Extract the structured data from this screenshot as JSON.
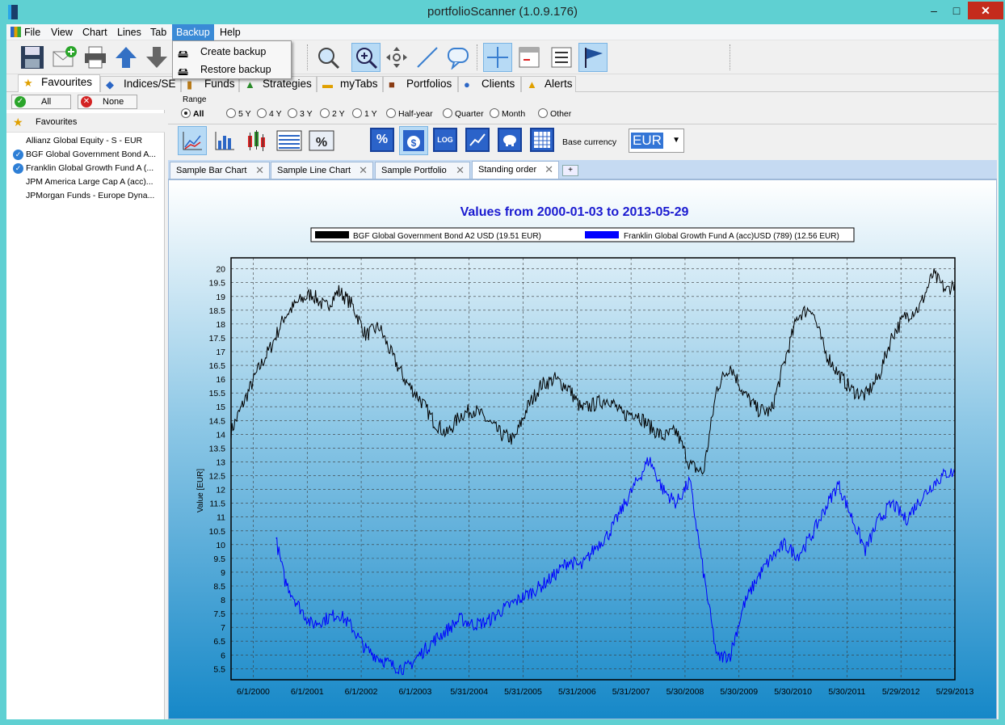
{
  "window": {
    "title": "portfolioScanner (1.0.9.176)",
    "min_glyph": "–",
    "max_glyph": "□",
    "close_glyph": "✕"
  },
  "menu": [
    "File",
    "View",
    "Chart",
    "Lines",
    "Tab",
    "Backup",
    "Help"
  ],
  "backup_menu": {
    "items": [
      "Create backup",
      "Restore backup"
    ]
  },
  "toolbar": {
    "icons": [
      "save-icon",
      "email-add-icon",
      "print-icon",
      "arrow-up-icon",
      "arrow-down-icon",
      "zoom-icon",
      "zoom-in-icon",
      "pan-icon",
      "line-draw-icon",
      "comment-icon",
      "crosshair-icon",
      "calendar-icon",
      "list-icon",
      "flag-icon"
    ]
  },
  "main_tabs": [
    "Favourites",
    "Indices/SE",
    "Funds",
    "Strategies",
    "myTabs",
    "Portfolios",
    "Clients",
    "Alerts"
  ],
  "left": {
    "all_label": "All",
    "none_label": "None",
    "header": "Favourites",
    "items": [
      {
        "label": "Allianz Global Equity - S - EUR",
        "checked": false
      },
      {
        "label": "BGF Global Government Bond A...",
        "checked": true
      },
      {
        "label": "Franklin Global Growth Fund A (...",
        "checked": true
      },
      {
        "label": "JPM America Large Cap A (acc)...",
        "checked": false
      },
      {
        "label": "JPMorgan Funds - Europe Dyna...",
        "checked": false
      }
    ]
  },
  "range": {
    "title": "Range",
    "options": [
      "All",
      "5 Y",
      "4 Y",
      "3 Y",
      "2 Y",
      "1 Y",
      "Half-year",
      "Quarter",
      "Month",
      "Other"
    ],
    "selected": "All"
  },
  "chart_tools": {
    "base_currency_label": "Base currency",
    "base_currency": "EUR",
    "percent_label": "%",
    "log_label": "LOG"
  },
  "chart_tabs": [
    "Sample Bar Chart",
    "Sample Line Chart",
    "Sample Portfolio",
    "Standing order"
  ],
  "chart_tabs_selected": "Standing order",
  "chart_data": {
    "type": "line",
    "title": "Values from 2000-01-03 to 2013-05-29",
    "ylabel": "Value [EUR]",
    "xlabel": "",
    "ylim": [
      5.1,
      20.4
    ],
    "yticks": [
      5.5,
      6,
      6.5,
      7,
      7.5,
      8,
      8.5,
      9,
      9.5,
      10,
      10.5,
      11,
      11.5,
      12,
      12.5,
      13,
      13.5,
      14,
      14.5,
      15,
      15.5,
      16,
      16.5,
      17,
      17.5,
      18,
      18.5,
      19,
      19.5,
      20
    ],
    "xlim": [
      "2000-01-03",
      "2013-05-29"
    ],
    "xticks": [
      "6/1/2000",
      "6/1/2001",
      "6/1/2002",
      "6/1/2003",
      "5/31/2004",
      "5/31/2005",
      "5/31/2006",
      "5/31/2007",
      "5/30/2008",
      "5/30/2009",
      "5/30/2010",
      "5/30/2011",
      "5/29/2012",
      "5/29/2013"
    ],
    "xtick_dates": [
      "2000-06-01",
      "2001-06-01",
      "2002-06-01",
      "2003-06-01",
      "2004-05-31",
      "2005-05-31",
      "2006-05-31",
      "2007-05-31",
      "2008-05-30",
      "2009-05-30",
      "2010-05-30",
      "2011-05-30",
      "2012-05-29",
      "2013-05-29"
    ],
    "grid": true,
    "legend_position": "top-center",
    "series": [
      {
        "name": "BGF Global Government Bond A2 USD (19.51 EUR)",
        "color": "#000000",
        "x": [
          "2000-01-03",
          "2000-04-01",
          "2000-07-01",
          "2000-10-01",
          "2001-01-01",
          "2001-04-01",
          "2001-07-01",
          "2001-10-01",
          "2002-01-01",
          "2002-04-01",
          "2002-07-01",
          "2002-10-01",
          "2003-01-01",
          "2003-04-01",
          "2003-07-01",
          "2003-10-01",
          "2004-01-01",
          "2004-04-01",
          "2004-07-01",
          "2004-10-01",
          "2005-01-01",
          "2005-04-01",
          "2005-07-01",
          "2005-10-01",
          "2006-01-01",
          "2006-04-01",
          "2006-07-01",
          "2006-10-01",
          "2007-01-01",
          "2007-04-01",
          "2007-07-01",
          "2007-10-01",
          "2008-01-01",
          "2008-04-01",
          "2008-07-01",
          "2008-10-01",
          "2009-01-01",
          "2009-04-01",
          "2009-07-01",
          "2009-10-01",
          "2010-01-01",
          "2010-04-01",
          "2010-07-01",
          "2010-10-01",
          "2011-01-01",
          "2011-04-01",
          "2011-07-01",
          "2011-10-01",
          "2012-01-01",
          "2012-04-01",
          "2012-07-01",
          "2012-10-01",
          "2013-01-01",
          "2013-04-01",
          "2013-05-29"
        ],
        "values": [
          14.1,
          15.2,
          16.3,
          17.2,
          18.3,
          18.8,
          19.1,
          18.6,
          19.2,
          18.7,
          17.6,
          17.9,
          16.8,
          15.9,
          15.3,
          14.5,
          14.0,
          14.7,
          14.9,
          14.5,
          14.0,
          13.8,
          15.0,
          15.8,
          16.0,
          15.7,
          14.9,
          15.1,
          15.3,
          14.7,
          14.8,
          14.3,
          13.9,
          14.1,
          12.9,
          12.6,
          15.7,
          16.5,
          15.5,
          14.9,
          14.8,
          16.6,
          18.3,
          18.6,
          17.0,
          16.2,
          15.6,
          15.4,
          16.1,
          17.6,
          18.3,
          18.6,
          19.8,
          19.2,
          19.5
        ]
      },
      {
        "name": "Franklin Global Growth Fund A (acc)USD (789) (12.56 EUR)",
        "color": "#0000ff",
        "x": [
          "2000-11-01",
          "2001-01-01",
          "2001-04-01",
          "2001-07-01",
          "2001-10-01",
          "2002-01-01",
          "2002-04-01",
          "2002-07-01",
          "2002-10-01",
          "2003-01-01",
          "2003-04-01",
          "2003-07-01",
          "2003-10-01",
          "2004-01-01",
          "2004-04-01",
          "2004-07-01",
          "2004-10-01",
          "2005-01-01",
          "2005-04-01",
          "2005-07-01",
          "2005-10-01",
          "2006-01-01",
          "2006-04-01",
          "2006-07-01",
          "2006-10-01",
          "2007-01-01",
          "2007-04-01",
          "2007-07-01",
          "2007-10-01",
          "2008-01-01",
          "2008-04-01",
          "2008-07-01",
          "2008-10-01",
          "2009-01-01",
          "2009-04-01",
          "2009-07-01",
          "2009-10-01",
          "2010-01-01",
          "2010-04-01",
          "2010-07-01",
          "2010-10-01",
          "2011-01-01",
          "2011-04-01",
          "2011-07-01",
          "2011-10-01",
          "2012-01-01",
          "2012-04-01",
          "2012-07-01",
          "2012-10-01",
          "2013-01-01",
          "2013-04-01",
          "2013-05-29"
        ],
        "values": [
          10.2,
          8.7,
          7.8,
          7.1,
          7.3,
          7.5,
          7.0,
          6.2,
          5.9,
          5.6,
          5.5,
          6.0,
          6.5,
          6.9,
          7.3,
          7.1,
          7.2,
          7.6,
          7.9,
          8.2,
          8.5,
          8.9,
          9.4,
          9.2,
          9.9,
          10.4,
          11.3,
          12.2,
          13.1,
          12.0,
          11.5,
          12.3,
          9.0,
          5.9,
          6.0,
          7.8,
          8.8,
          9.5,
          10.0,
          9.6,
          10.3,
          11.3,
          12.2,
          11.0,
          9.8,
          10.9,
          11.5,
          10.9,
          11.6,
          12.2,
          12.6,
          12.6
        ]
      }
    ]
  }
}
